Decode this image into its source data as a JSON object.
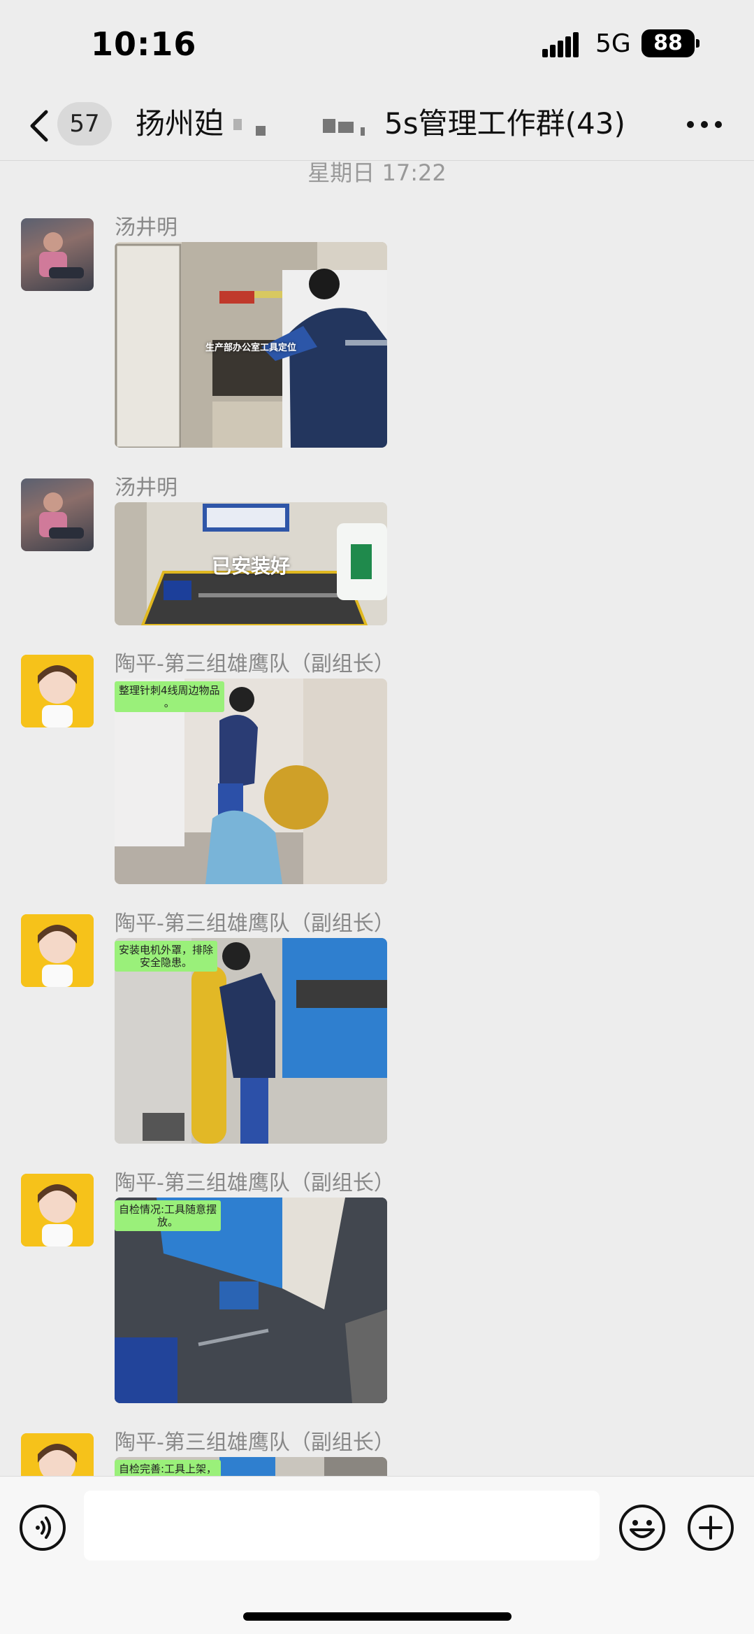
{
  "status": {
    "time": "10:16",
    "network": "5G",
    "battery": "88"
  },
  "nav": {
    "unread_count": "57",
    "title_prefix": "扬州廹",
    "title_suffix": "5s管理工作群(43)"
  },
  "timestamp": "星期日 17:22",
  "messages": [
    {
      "sender": "汤井明",
      "caption": "生产部办公室工具定位"
    },
    {
      "sender": "汤井明",
      "caption": "已安装好"
    },
    {
      "sender": "陶平-第三组雄鹰队（副组长）",
      "caption": "整理针刺4线周边物品\n。"
    },
    {
      "sender": "陶平-第三组雄鹰队（副组长）",
      "caption": "安装电机外罩，排除\n安全隐患。"
    },
    {
      "sender": "陶平-第三组雄鹰队（副组长）",
      "caption": "自检情况:工具随意摆\n放。"
    },
    {
      "sender": "陶平-第三组雄鹰队（副组长）",
      "caption": "自检完善:工具上架，\n清洁卫生"
    }
  ],
  "input": {
    "placeholder": ""
  }
}
